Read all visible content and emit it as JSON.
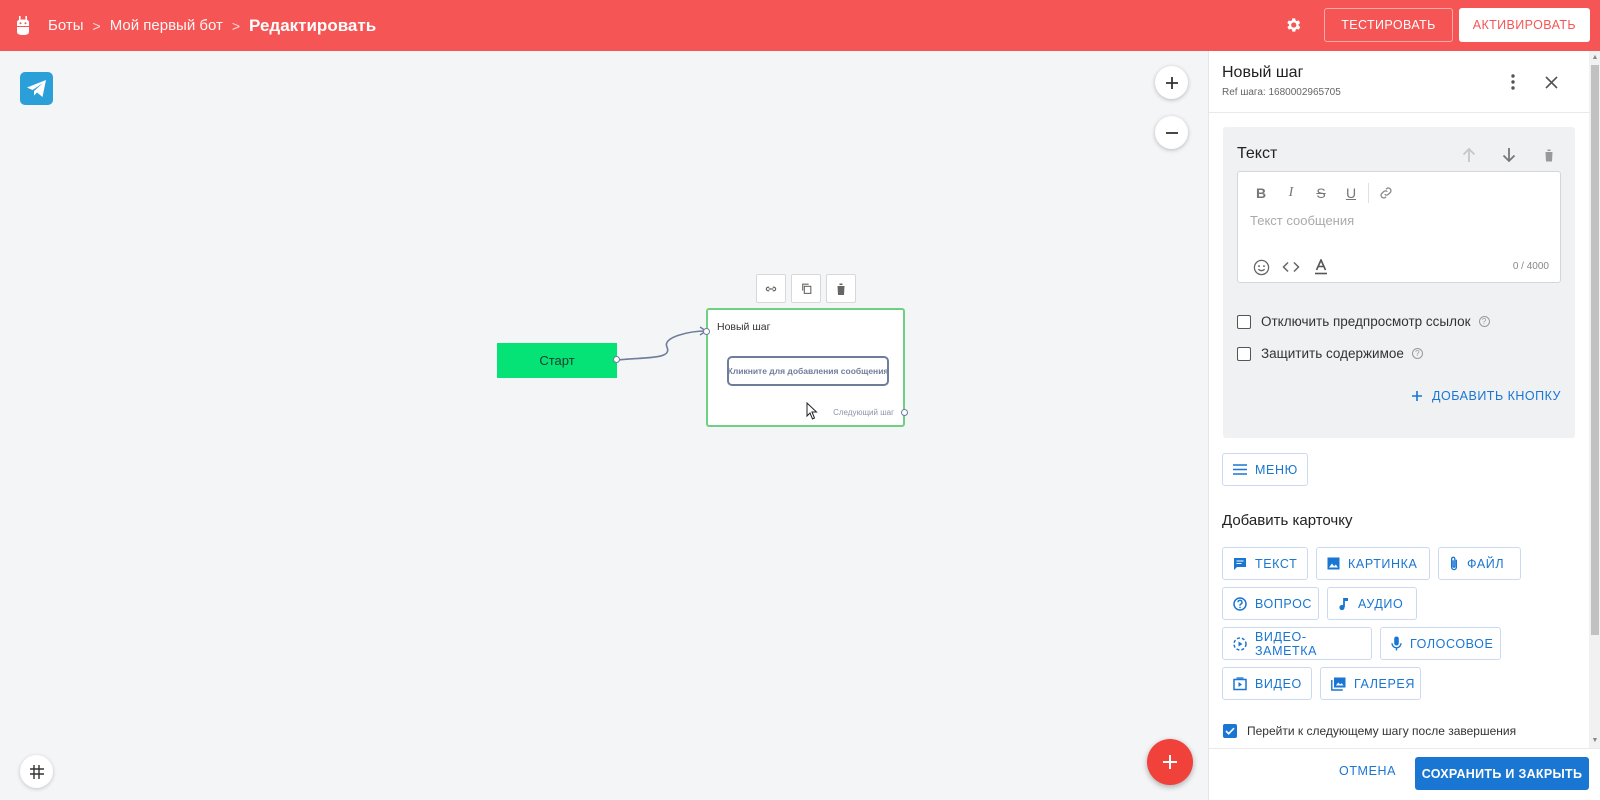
{
  "breadcrumb": {
    "root": "Боты",
    "bot": "Мой первый бот",
    "current": "Редактировать",
    "separator": ">"
  },
  "header": {
    "test_label": "ТЕСТИРОВАТЬ",
    "activate_label": "АКТИВИРОВАТЬ"
  },
  "colors": {
    "topbar": "#f55555",
    "accent": "#1976d2",
    "start_node": "#05e276",
    "step_border": "#6fd084",
    "fab": "#f0413a"
  },
  "canvas": {
    "start_label": "Старт",
    "step": {
      "title": "Новый шаг",
      "message_placeholder": "Кликните для добавления сообщения",
      "next_label": "Следующий шаг"
    }
  },
  "panel": {
    "title": "Новый шаг",
    "ref": "Ref шага: 1680002965705",
    "text_card": {
      "title": "Текст",
      "placeholder": "Текст сообщения",
      "counter": "0 / 4000",
      "format_tools": [
        "B",
        "I",
        "S",
        "U"
      ]
    },
    "options": {
      "disable_preview": "Отключить предпросмотр ссылок",
      "protect_content": "Защитить содержимое"
    },
    "add_button_label": "ДОБАВИТЬ КНОПКУ",
    "menu_label": "МЕНЮ",
    "add_card_title": "Добавить карточку",
    "cards": {
      "text": "ТЕКСТ",
      "image": "КАРТИНКА",
      "file": "ФАЙЛ",
      "question": "ВОПРОС",
      "audio": "АУДИО",
      "video_note": "ВИДЕО-ЗАМЕТКА",
      "voice": "ГОЛОСОВОЕ",
      "video": "ВИДЕО",
      "gallery": "ГАЛЕРЕЯ"
    },
    "goto_next": "Перейти к следующему шагу после завершения",
    "cancel_label": "ОТМЕНА",
    "save_label": "СОХРАНИТЬ И ЗАКРЫТЬ"
  }
}
